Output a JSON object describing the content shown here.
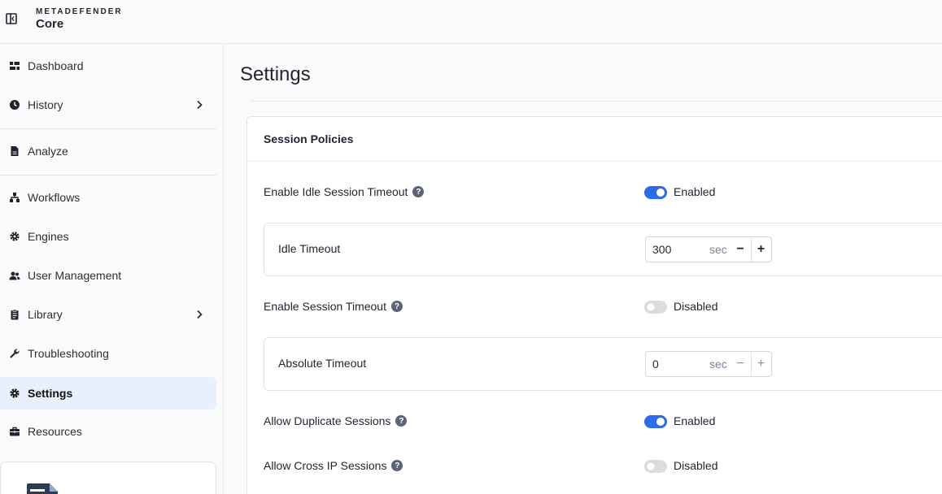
{
  "brand": {
    "top": "METADEFENDER",
    "product": "Core"
  },
  "sidebar": {
    "items": [
      {
        "label": "Dashboard"
      },
      {
        "label": "History"
      },
      {
        "label": "Analyze"
      },
      {
        "label": "Workflows"
      },
      {
        "label": "Engines"
      },
      {
        "label": "User Management"
      },
      {
        "label": "Library"
      },
      {
        "label": "Troubleshooting"
      },
      {
        "label": "Settings"
      },
      {
        "label": "Resources"
      }
    ]
  },
  "page": {
    "title": "Settings"
  },
  "session": {
    "title": "Session Policies",
    "idle_enable": {
      "label": "Enable Idle Session Timeout",
      "state": "Enabled"
    },
    "idle_timeout": {
      "label": "Idle Timeout",
      "value": "300",
      "unit": "sec"
    },
    "session_enable": {
      "label": "Enable Session Timeout",
      "state": "Disabled"
    },
    "absolute_timeout": {
      "label": "Absolute Timeout",
      "value": "0",
      "unit": "sec"
    },
    "duplicate": {
      "label": "Allow Duplicate Sessions",
      "state": "Enabled"
    },
    "cross_ip": {
      "label": "Allow Cross IP Sessions",
      "state": "Disabled"
    }
  },
  "colors": {
    "accent": "#2e6be6",
    "active_bg": "#e8effd"
  }
}
